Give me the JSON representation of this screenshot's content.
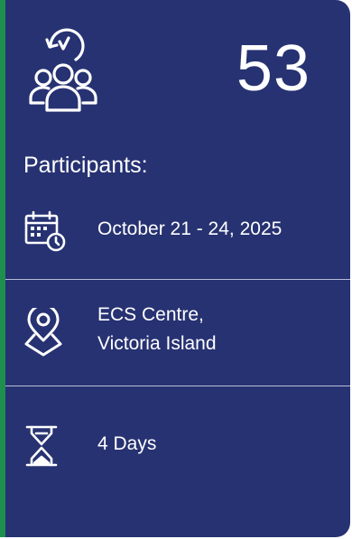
{
  "participants": {
    "count": "53",
    "label": "Participants:"
  },
  "details": {
    "date": "October 21 - 24, 2025",
    "location_line1": "ECS Centre,",
    "location_line2": "Victoria Island",
    "duration": "4 Days"
  },
  "icons": {
    "participants": "team-clock-icon",
    "date": "calendar-clock-icon",
    "location": "map-pin-icon",
    "duration": "hourglass-icon"
  },
  "colors": {
    "card_background": "#273272",
    "accent_bar": "#1f8f4e",
    "text": "#ffffff",
    "divider": "#b7bed9"
  }
}
